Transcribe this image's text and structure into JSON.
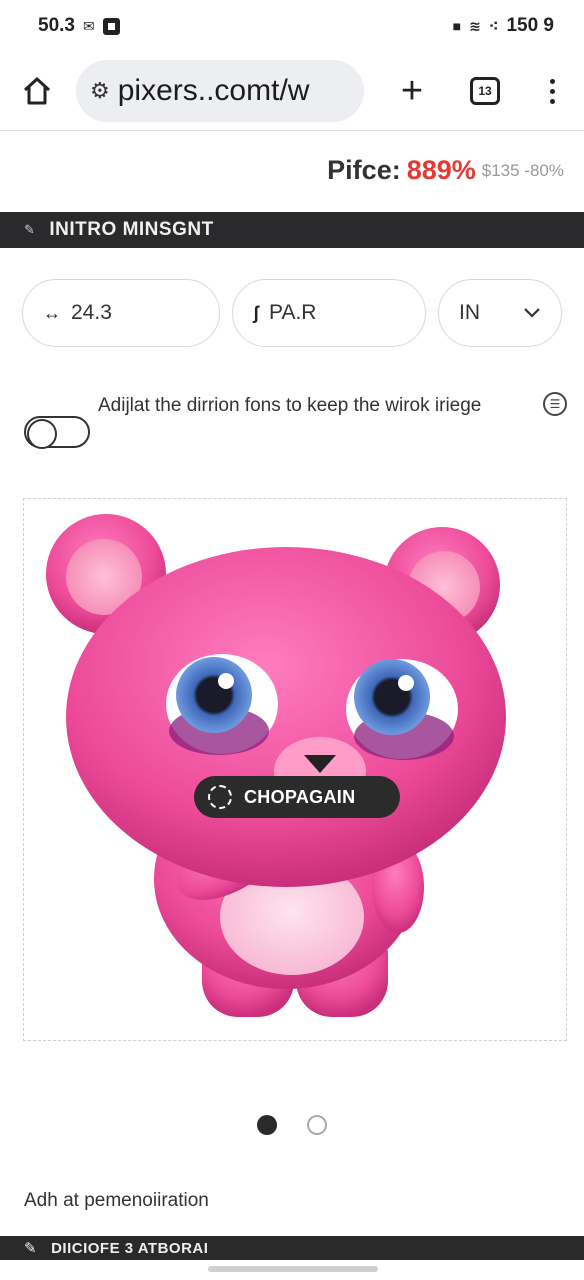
{
  "status_bar": {
    "left_text": "50.3",
    "right_text": "150 9"
  },
  "browser": {
    "url": "pixers..comt/w",
    "tab_count": "13"
  },
  "price": {
    "label": "Pifce:",
    "value": "889%",
    "old": "$135 -80%"
  },
  "section_header": {
    "title": "INITRO MINSGNT"
  },
  "options": {
    "size": "24.3",
    "material": "PA.R",
    "unit": "IN"
  },
  "toggle": {
    "text": "Adijlat the dirrion fons to keep the wirok iriege"
  },
  "image": {
    "badge_label": "CHOPAGAIN",
    "dots_total": 2,
    "active_dot": 1
  },
  "footer": {
    "text": "Adh at pemenoiiration",
    "bottom_header": "DIICIOFE 3 ATBORAI"
  },
  "colors": {
    "price_red": "#e53935",
    "header_dark": "#2a2a2d",
    "bear_pink": "#f0509a"
  }
}
